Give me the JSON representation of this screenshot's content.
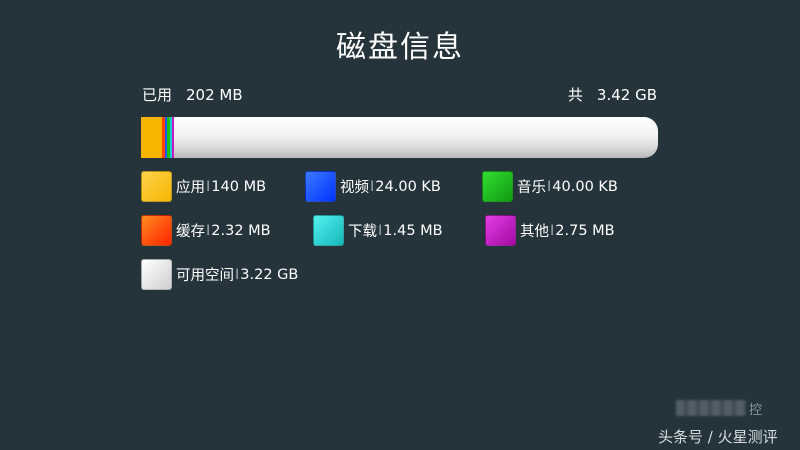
{
  "title": "磁盘信息",
  "used": {
    "label": "已用",
    "value": "202 MB"
  },
  "total": {
    "label": "共",
    "value": "3.42 GB"
  },
  "storage_bar": [
    {
      "name": "应用",
      "color": "#f7b500",
      "fraction": 0.04
    },
    {
      "name": "缓存",
      "color": "#ff4400",
      "fraction": 0.0066
    },
    {
      "name": "视频",
      "color": "#1a55ff",
      "fraction": 0.0045
    },
    {
      "name": "音乐",
      "color": "#19c31a",
      "fraction": 0.0045
    },
    {
      "name": "下载",
      "color": "#1ccfcf",
      "fraction": 0.0045
    },
    {
      "name": "其他",
      "color": "#c31ac3",
      "fraction": 0.0045
    },
    {
      "name": "可用空间",
      "color": "free",
      "fraction": 0.9354
    }
  ],
  "legend": [
    {
      "key": "apps",
      "label": "应用",
      "size": "140 MB",
      "color": "#f7b500",
      "color2": "#ffd34d",
      "icon": "apps-swatch"
    },
    {
      "key": "video",
      "label": "视频",
      "size": "24.00 KB",
      "color": "#0033ff",
      "color2": "#3d78ff",
      "icon": "video-swatch"
    },
    {
      "key": "music",
      "label": "音乐",
      "size": "40.00 KB",
      "color": "#119a11",
      "color2": "#33dd33",
      "icon": "music-swatch"
    },
    {
      "key": "cache",
      "label": "缓存",
      "size": "2.32 MB",
      "color": "#ff2200",
      "color2": "#ff8a1f",
      "icon": "cache-swatch"
    },
    {
      "key": "download",
      "label": "下载",
      "size": "1.45 MB",
      "color": "#14b8b8",
      "color2": "#55f0f0",
      "icon": "download-swatch"
    },
    {
      "key": "other",
      "label": "其他",
      "size": "2.75 MB",
      "color": "#a10aa1",
      "color2": "#e23fe2",
      "icon": "other-swatch"
    },
    {
      "key": "free",
      "label": "可用空间",
      "size": "3.22 GB",
      "color": "#cfcfcf",
      "color2": "#ffffff",
      "icon": "free-swatch"
    }
  ],
  "separator": "I",
  "watermark": "头条号 / 火星测评",
  "watermark_partial": "控"
}
